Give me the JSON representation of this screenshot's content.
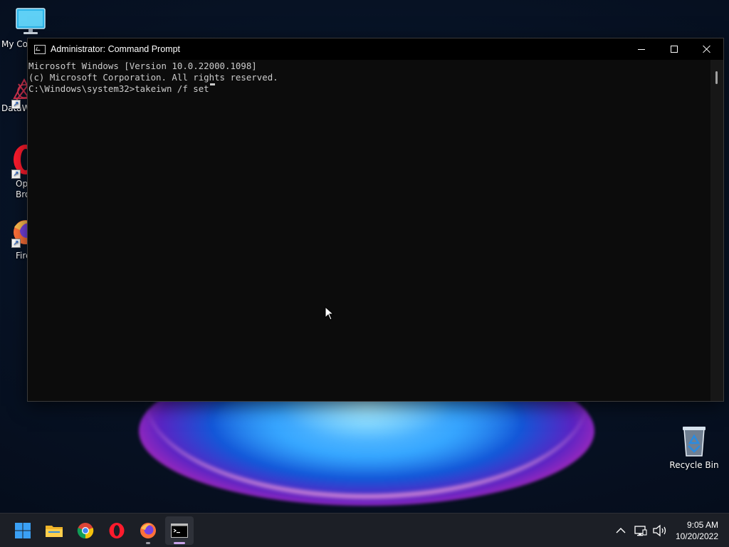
{
  "desktop": {
    "icons": [
      {
        "label": "My Co",
        "icon": "monitor-icon"
      },
      {
        "label": "DataW",
        "icon": "datawrapper-icon"
      },
      {
        "label": "Op\nBrow",
        "icon": "opera-icon"
      },
      {
        "label": "Fire",
        "icon": "firefox-icon"
      },
      {
        "label": "Recycle Bin",
        "icon": "recycle-bin-icon"
      }
    ]
  },
  "window": {
    "title": "Administrator: Command Prompt",
    "controls": {
      "minimize": "minimize-icon",
      "maximize": "maximize-icon",
      "close": "close-icon"
    },
    "console_lines": [
      "Microsoft Windows [Version 10.0.22000.1098]",
      "(c) Microsoft Corporation. All rights reserved.",
      "C:\\Windows\\system32>takeiwn /f set"
    ]
  },
  "taskbar": {
    "apps": [
      {
        "name": "Start",
        "icon": "windows-start-icon"
      },
      {
        "name": "File Explorer",
        "icon": "folder-icon"
      },
      {
        "name": "Google Chrome",
        "icon": "chrome-icon"
      },
      {
        "name": "Opera",
        "icon": "opera-icon"
      },
      {
        "name": "Firefox",
        "icon": "firefox-icon"
      },
      {
        "name": "Command Prompt",
        "icon": "terminal-icon"
      }
    ],
    "tray": {
      "chevron": "chevron-up-icon",
      "network": "network-icon",
      "volume": "volume-icon",
      "time": "9:05 AM",
      "date": "10/20/2022"
    }
  },
  "colors": {
    "console_bg": "#0c0c0c",
    "console_text": "#cccccc",
    "taskbar_bg": "#1c1f26",
    "active_indicator": "#c8a2e8"
  }
}
